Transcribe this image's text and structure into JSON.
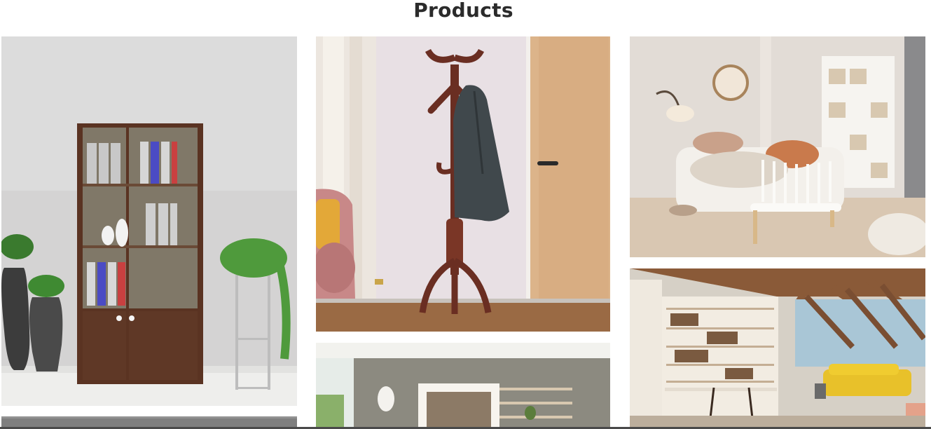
{
  "page": {
    "title": "Products"
  },
  "products": [
    {
      "name": "glass-door-cabinet"
    },
    {
      "name": "coat-rack-stand"
    },
    {
      "name": "kids-room-daybed"
    },
    {
      "name": "study-room-interior"
    },
    {
      "name": "loft-library-interior"
    },
    {
      "name": "grey-cabinet-partial"
    }
  ],
  "colors": {
    "title": "#2b2b2b",
    "walnut": "#5a3322",
    "background": "#ffffff"
  }
}
